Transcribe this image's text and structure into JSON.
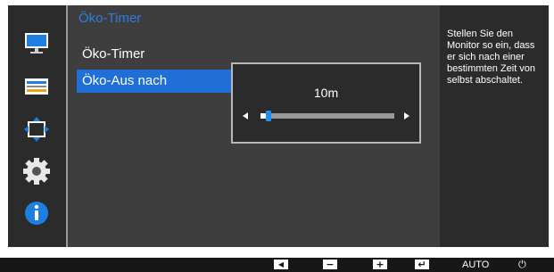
{
  "menu": {
    "title": "Öko-Timer",
    "items": [
      {
        "label": "Öko-Timer"
      },
      {
        "label": "Öko-Aus nach"
      }
    ]
  },
  "popup": {
    "value": "10m",
    "slider_fraction": 0.06
  },
  "help": {
    "text": "Stellen Sie den Monitor so ein, dass er sich nach einer bestimmten Zeit von selbst abschaltet."
  },
  "sidebar_icons": [
    "monitor-icon",
    "picture-settings-icon",
    "position-resize-icon",
    "gear-icon",
    "information-icon"
  ],
  "bottom_bar": {
    "left_symbol": "◀",
    "minus_symbol": "−",
    "plus_symbol": "+",
    "enter_symbol": "↵",
    "auto_label": "AUTO",
    "power_symbol": "⏻"
  },
  "colors": {
    "accent": "#1f6fd6",
    "title_blue": "#2d7de0",
    "background": "#292929"
  }
}
